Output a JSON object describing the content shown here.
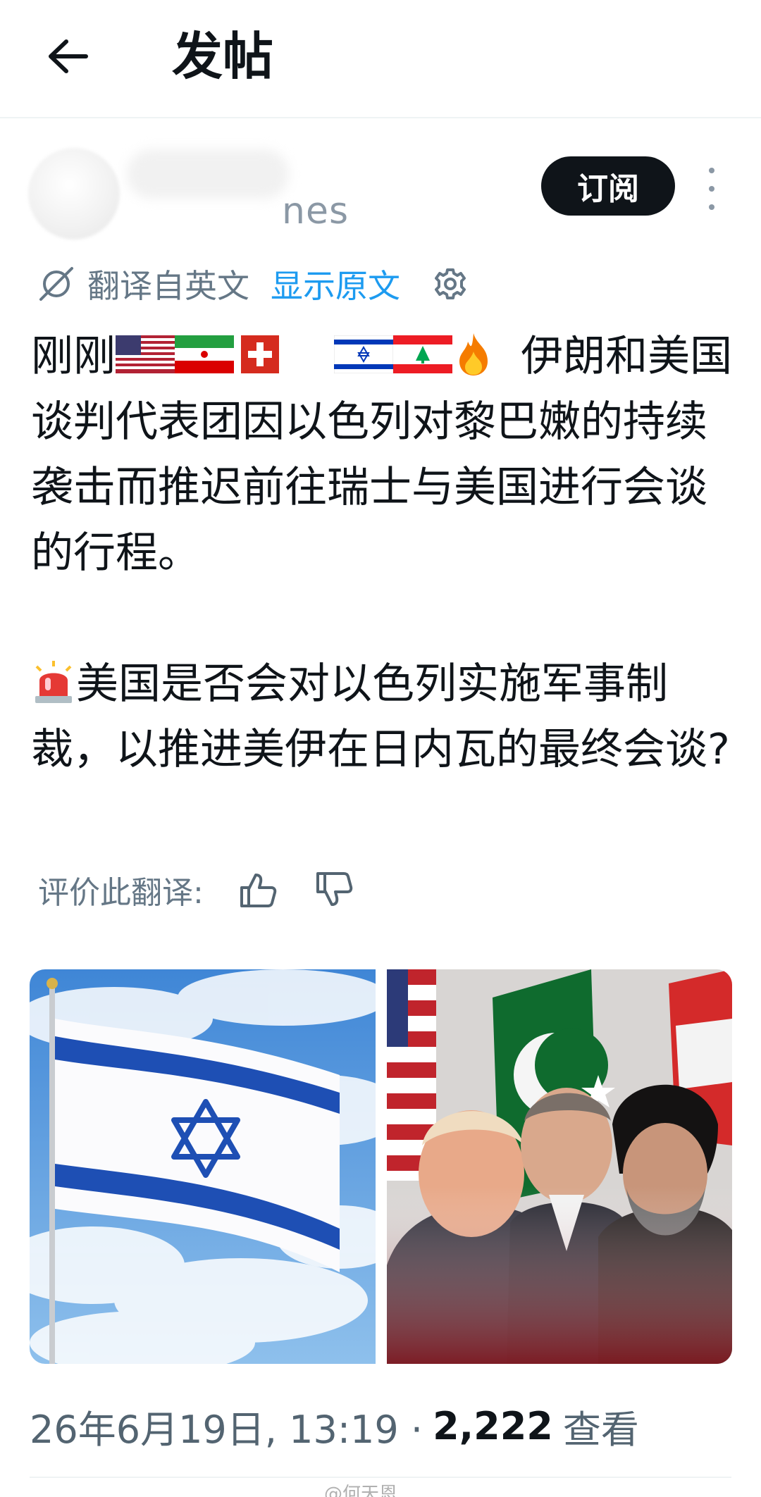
{
  "header": {
    "back_icon": "arrow-left-icon",
    "title": "发帖"
  },
  "author": {
    "handle_visible": "nes",
    "subscribe_label": "订阅",
    "more_icon": "more-vertical-icon"
  },
  "translation": {
    "icon": "translate-icon",
    "label": "翻译自英文",
    "show_original": "显示原文",
    "settings_icon": "gear-icon"
  },
  "post": {
    "line1_prefix": "刚刚",
    "line1_suffix": "伊朗和",
    "para1_rest": "美国谈判代表团因以色列对黎巴嫩的持续袭击而推迟前往瑞士与美国进行会谈的行程。",
    "para2": "美国是否会对以色列实施军事制裁，以推进美伊在日内瓦的最终会谈?",
    "flags": [
      "us-flag",
      "iran-flag",
      "switzerland-flag",
      "israel-flag",
      "lebanon-flag"
    ],
    "emojis": [
      "fire-emoji",
      "siren-emoji"
    ]
  },
  "rating": {
    "label": "评价此翻译:",
    "up_icon": "thumbs-up-icon",
    "down_icon": "thumbs-down-icon"
  },
  "media": [
    {
      "name": "israel-flag-image"
    },
    {
      "name": "leaders-flags-image"
    }
  ],
  "meta": {
    "date_time": "26年6月19日, 13:19 ·",
    "views": "2,222",
    "views_label": "查看"
  },
  "watermark": {
    "text": "@何天恩"
  },
  "colors": {
    "accent": "#1d9bf0",
    "text": "#0f1419",
    "muted": "#657786",
    "button_bg": "#0f1419"
  }
}
